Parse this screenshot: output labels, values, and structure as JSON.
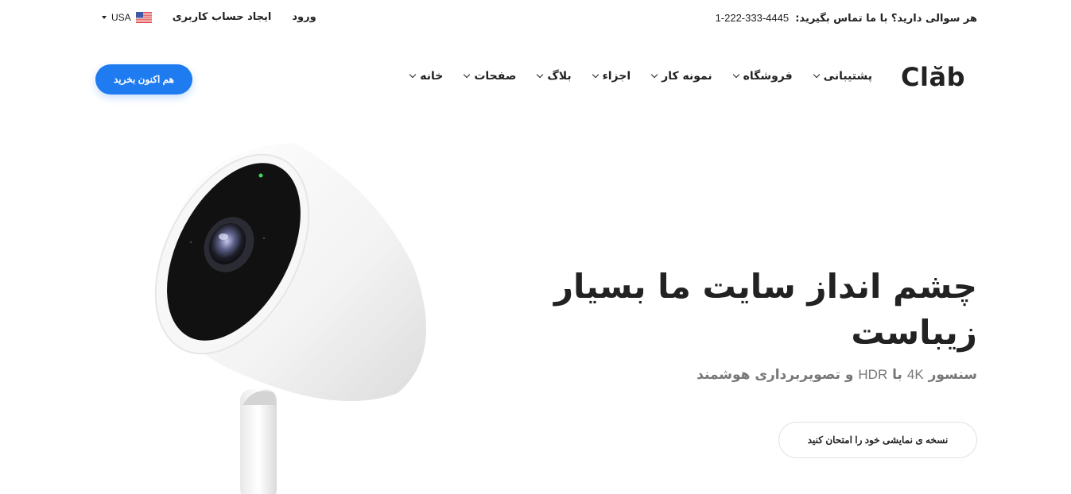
{
  "topbar": {
    "contact_question": "هر سوالی دارید؟ با ما تماس بگیرید:",
    "phone": "1-222-333-4445",
    "locale": "USA",
    "register": "ایجاد حساب کاربری",
    "login": "ورود"
  },
  "header": {
    "logo": "Clăb",
    "nav": [
      {
        "label": "خانه"
      },
      {
        "label": "صفحات"
      },
      {
        "label": "بلاگ"
      },
      {
        "label": "اجزاء"
      },
      {
        "label": "نمونه کار"
      },
      {
        "label": "فروشگاه"
      },
      {
        "label": "پشتیبانی"
      }
    ],
    "buy_button": "هم اکنون بخرید"
  },
  "hero": {
    "title": "چشم انداز سایت ما بسیار زیباست",
    "subtitle_part1": "سنسور",
    "subtitle_4k": "4K",
    "subtitle_part2": "با",
    "subtitle_hdr": "HDR",
    "subtitle_part3": "و تصویربرداری هوشمند",
    "demo_button": "نسخه ی نمایشی خود را امتحان کنید"
  },
  "colors": {
    "accent": "#1e7bf0",
    "text": "#222222",
    "muted": "#777777"
  }
}
